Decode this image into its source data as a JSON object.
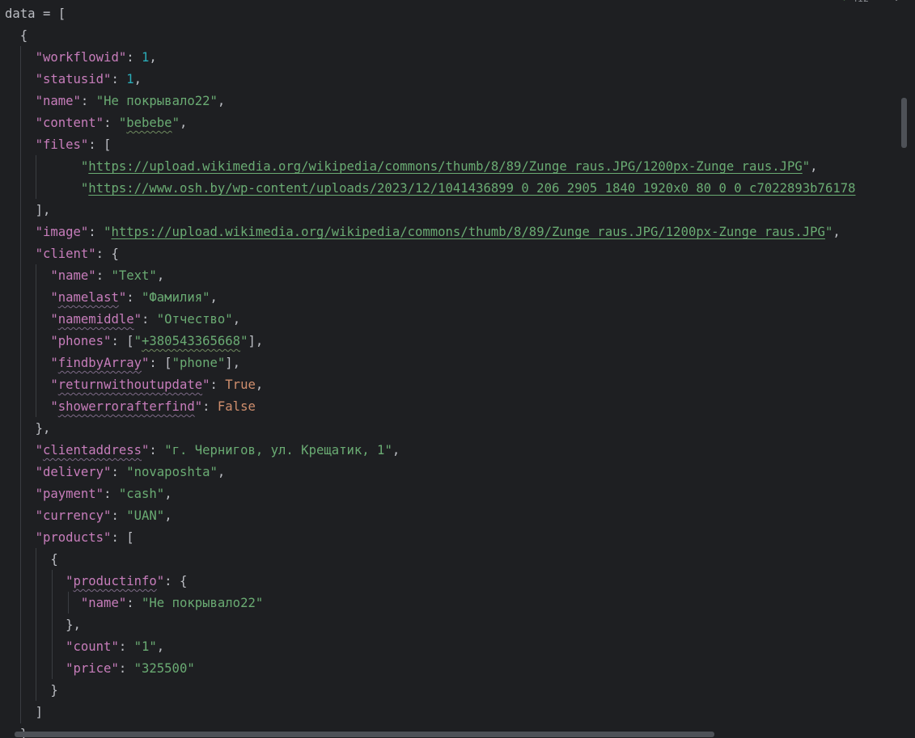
{
  "editor": {
    "warning_count": "412",
    "scroll_up_icon": "chevron-up-icon",
    "scroll_down_icon": "chevron-down-icon"
  },
  "code": {
    "l1": {
      "var": "data",
      "op": " = ["
    },
    "l2": {
      "t": "{"
    },
    "l3": {
      "k": "\"workflowid\"",
      "sep": ": ",
      "v": "1",
      "end": ","
    },
    "l4": {
      "k": "\"statusid\"",
      "sep": ": ",
      "v": "1",
      "end": ","
    },
    "l5": {
      "k": "\"name\"",
      "sep": ": ",
      "v": "\"Не покрывало22\"",
      "end": ","
    },
    "l6": {
      "k": "\"content\"",
      "sep": ": ",
      "q1": "\"",
      "v": "bebebe",
      "q2": "\"",
      "end": ","
    },
    "l7": {
      "k": "\"files\"",
      "sep": ": ["
    },
    "l8": {
      "q1": "\"",
      "v": "https://upload.wikimedia.org/wikipedia/commons/thumb/8/89/Zunge_raus.JPG/1200px-Zunge_raus.JPG",
      "q2": "\"",
      "end": ","
    },
    "l9": {
      "q1": "\"",
      "v": "https://www.osh.by/wp-content/uploads/2023/12/1041436899_0_206_2905_1840_1920x0_80_0_0_c7022893b76178"
    },
    "l10": {
      "t": "],"
    },
    "l11": {
      "k": "\"image\"",
      "sep": ": ",
      "q1": "\"",
      "v": "https://upload.wikimedia.org/wikipedia/commons/thumb/8/89/Zunge_raus.JPG/1200px-Zunge_raus.JPG",
      "q2": "\"",
      "end": ","
    },
    "l12": {
      "k": "\"client\"",
      "sep": ": {"
    },
    "l13": {
      "k": "\"name\"",
      "sep": ": ",
      "v": "\"Text\"",
      "end": ","
    },
    "l14": {
      "q": "\"",
      "k": "namelast",
      "q2": "\"",
      "sep": ": ",
      "v": "\"Фамилия\"",
      "end": ","
    },
    "l15": {
      "q": "\"",
      "k": "namemiddle",
      "q2": "\"",
      "sep": ": ",
      "v": "\"Отчество\"",
      "end": ","
    },
    "l16": {
      "k": "\"phones\"",
      "sep": ": [",
      "q1": "\"",
      "v": "+380543365668",
      "q2": "\"",
      "end": "],"
    },
    "l17": {
      "q": "\"",
      "k": "findbyArray",
      "q2": "\"",
      "sep": ": [",
      "v": "\"phone\"",
      "end": "],"
    },
    "l18": {
      "q": "\"",
      "k": "returnwithoutupdate",
      "q2": "\"",
      "sep": ": ",
      "v": "True",
      "end": ","
    },
    "l19": {
      "q": "\"",
      "k": "showerrorafterfind",
      "q2": "\"",
      "sep": ": ",
      "v": "False"
    },
    "l20": {
      "t": "},"
    },
    "l21": {
      "q": "\"",
      "k": "clientaddress",
      "q2": "\"",
      "sep": ": ",
      "v": "\"г. Чернигов, ул. Крещатик, 1\"",
      "end": ","
    },
    "l22": {
      "k": "\"delivery\"",
      "sep": ": ",
      "v": "\"novaposhta\"",
      "end": ","
    },
    "l23": {
      "k": "\"payment\"",
      "sep": ": ",
      "v": "\"cash\"",
      "end": ","
    },
    "l24": {
      "k": "\"currency\"",
      "sep": ": ",
      "v": "\"UAN\"",
      "end": ","
    },
    "l25": {
      "k": "\"products\"",
      "sep": ": ["
    },
    "l26": {
      "t": "{"
    },
    "l27": {
      "q": "\"",
      "k": "productinfo",
      "q2": "\"",
      "sep": ": {"
    },
    "l28": {
      "k": "\"name\"",
      "sep": ": ",
      "v": "\"Не покрывало22\""
    },
    "l29": {
      "t": "},"
    },
    "l30": {
      "k": "\"count\"",
      "sep": ": ",
      "v": "\"1\"",
      "end": ","
    },
    "l31": {
      "k": "\"price\"",
      "sep": ": ",
      "v": "\"325500\""
    },
    "l32": {
      "t": "}"
    },
    "l33": {
      "t": "]"
    },
    "l34": {
      "t": "}"
    }
  }
}
